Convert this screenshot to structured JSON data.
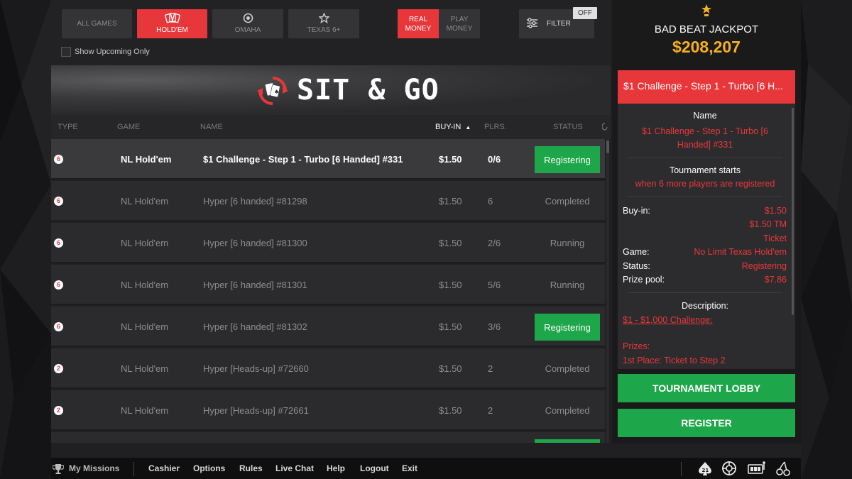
{
  "game_tabs": [
    {
      "label": "ALL GAMES",
      "icon": "none",
      "active": false
    },
    {
      "label": "HOLD'EM",
      "icon": "cards-icon",
      "active": true
    },
    {
      "label": "OMAHA",
      "icon": "chip-icon",
      "active": false
    },
    {
      "label": "TEXAS 6+",
      "icon": "star-icon",
      "active": false
    }
  ],
  "money_tabs": [
    {
      "label": "REAL MONEY",
      "active": true
    },
    {
      "label": "PLAY MONEY",
      "active": false
    }
  ],
  "filter": {
    "label": "FILTER",
    "state": "OFF"
  },
  "upcoming": {
    "label": "Show Upcoming Only",
    "checked": false
  },
  "banner": {
    "title": "SIT & GO"
  },
  "table": {
    "headers": {
      "type": "TYPE",
      "game": "GAME",
      "name": "NAME",
      "buyin": "BUY-IN",
      "plrs": "PLRS.",
      "status": "STATUS"
    },
    "rows": [
      {
        "badge": "6",
        "game": "NL Hold'em",
        "name": "$1 Challenge - Step 1 - Turbo [6 Handed] #331",
        "buyin": "$1.50",
        "plrs": "0/6",
        "status": "Registering",
        "button": true,
        "selected": true
      },
      {
        "badge": "6",
        "game": "NL Hold'em",
        "name": "Hyper [6 handed] #81298",
        "buyin": "$1.50",
        "plrs": "6",
        "status": "Completed",
        "button": false,
        "selected": false
      },
      {
        "badge": "6",
        "game": "NL Hold'em",
        "name": "Hyper [6 handed] #81300",
        "buyin": "$1.50",
        "plrs": "2/6",
        "status": "Running",
        "button": false,
        "selected": false
      },
      {
        "badge": "6",
        "game": "NL Hold'em",
        "name": "Hyper [6 handed] #81301",
        "buyin": "$1.50",
        "plrs": "5/6",
        "status": "Running",
        "button": false,
        "selected": false
      },
      {
        "badge": "6",
        "game": "NL Hold'em",
        "name": "Hyper [6 handed] #81302",
        "buyin": "$1.50",
        "plrs": "3/6",
        "status": "Registering",
        "button": true,
        "selected": false
      },
      {
        "badge": "2",
        "game": "NL Hold'em",
        "name": "Hyper [Heads-up] #72660",
        "buyin": "$1.50",
        "plrs": "2",
        "status": "Completed",
        "button": false,
        "selected": false
      },
      {
        "badge": "2",
        "game": "NL Hold'em",
        "name": "Hyper [Heads-up] #72661",
        "buyin": "$1.50",
        "plrs": "2",
        "status": "Completed",
        "button": false,
        "selected": false
      },
      {
        "badge": "",
        "game": "",
        "name": "",
        "buyin": "",
        "plrs": "",
        "status": "",
        "button": true,
        "selected": false
      }
    ]
  },
  "jackpot": {
    "label": "BAD BEAT JACKPOT",
    "amount": "$208,207"
  },
  "details": {
    "title": "$1 Challenge - Step 1 - Turbo [6 H...",
    "name_label": "Name",
    "name_value": "$1 Challenge - Step 1 - Turbo [6 Handed] #331",
    "starts_label": "Tournament starts",
    "starts_value": "when 6 more players are registered",
    "buyin_label": "Buy-in:",
    "buyin_value1": "$1.50",
    "buyin_value2": "$1.50 TM",
    "buyin_value3": "Ticket",
    "game_label": "Game:",
    "game_value": "No Limit Texas Hold'em",
    "status_label": "Status:",
    "status_value": "Registering",
    "prize_label": "Prize pool:",
    "prize_value": "$7.86",
    "desc_label": "Description:",
    "desc_link": "$1 - $1,000 Challenge:",
    "prizes_label": "Prizes:",
    "prizes_first": "1st Place: Ticket to Step 2"
  },
  "actions": {
    "lobby": "TOURNAMENT LOBBY",
    "register": "REGISTER"
  },
  "footer": {
    "missions": "My Missions",
    "links": [
      "Cashier",
      "Options",
      "Rules",
      "Live Chat",
      "Help",
      "Logout",
      "Exit"
    ],
    "icons": [
      "blackjack-21-icon",
      "roulette-icon",
      "slot-machine-icon",
      "cherries-icon"
    ]
  },
  "colors": {
    "accent": "#e8373a",
    "green": "#1ea64a",
    "gold": "#f5b021"
  }
}
